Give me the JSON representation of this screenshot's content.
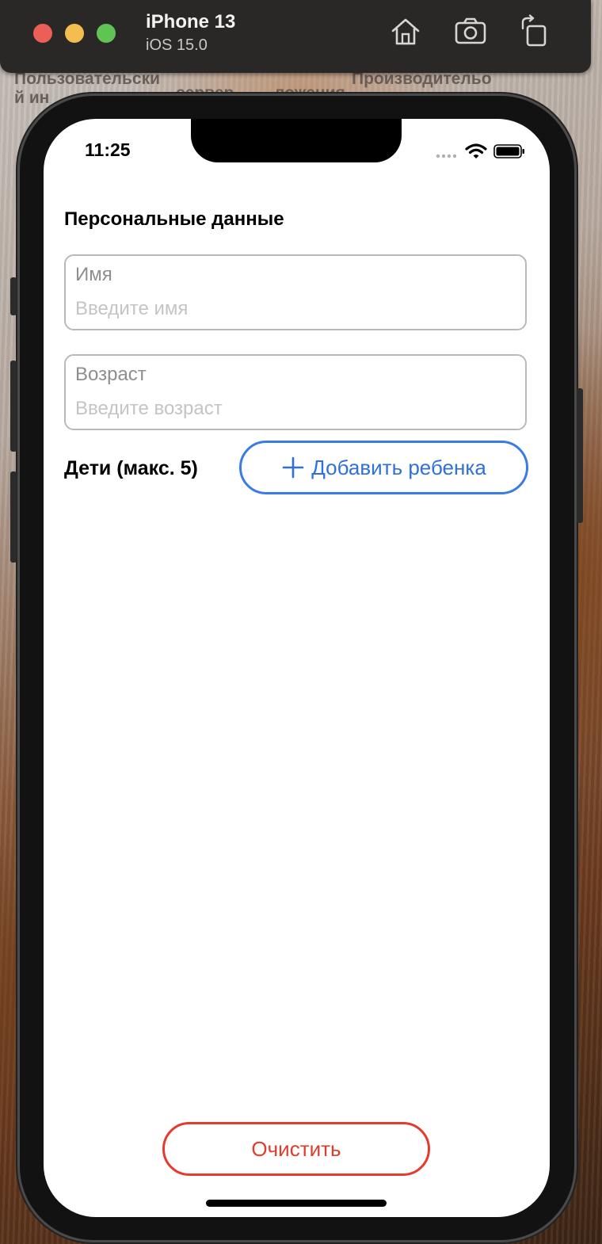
{
  "desktop": {
    "label_1_line1": "Пользовательски",
    "label_1_line2": "й ин",
    "label_2": "сервер",
    "label_3": "ложения",
    "label_4": "Производительо"
  },
  "simulator": {
    "device_name": "iPhone 13",
    "os_version": "iOS 15.0",
    "toolbar_icons": [
      "home-icon",
      "screenshot-icon",
      "rotate-icon"
    ]
  },
  "status_bar": {
    "time": "11:25",
    "icons": [
      "signal-dots-icon",
      "wifi-icon",
      "battery-icon"
    ]
  },
  "form": {
    "section_title": "Персональные данные",
    "name_field": {
      "label": "Имя",
      "placeholder": "Введите имя",
      "value": ""
    },
    "age_field": {
      "label": "Возраст",
      "placeholder": "Введите возраст",
      "value": ""
    },
    "children_title": "Дети (макс. 5)",
    "add_child_label": "Добавить ребенка",
    "clear_label": "Очистить"
  },
  "colors": {
    "accent_blue": "#3a7be8",
    "destructive_red": "#e53a2c",
    "field_border": "#b9b9b9"
  }
}
